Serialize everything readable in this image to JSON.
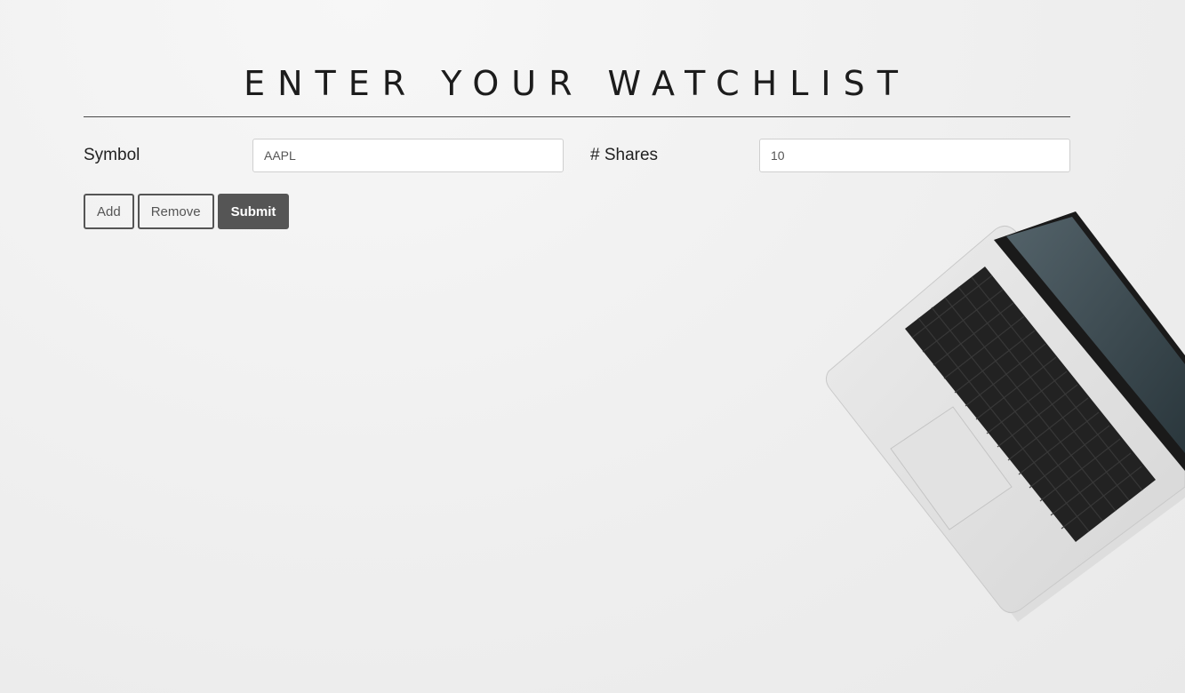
{
  "header": {
    "title": "ENTER YOUR WATCHLIST"
  },
  "form": {
    "symbol_label": "Symbol",
    "symbol_value": "AAPL",
    "shares_label": "# Shares",
    "shares_value": "10"
  },
  "buttons": {
    "add_label": "Add",
    "remove_label": "Remove",
    "submit_label": "Submit"
  },
  "decor": {
    "laptop_icon": "laptop-photo"
  }
}
